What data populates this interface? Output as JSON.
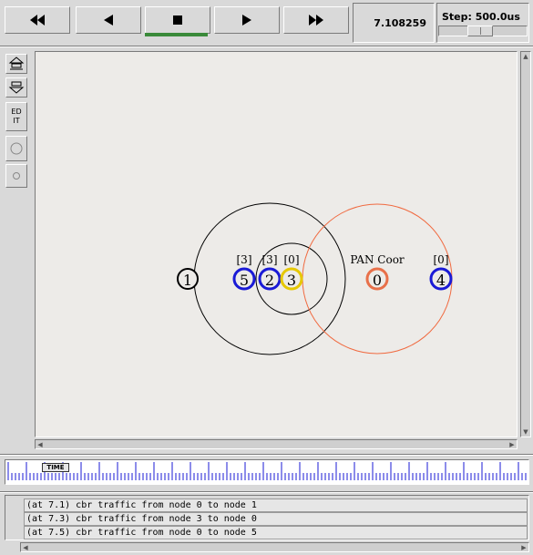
{
  "toolbar": {
    "rewind_icon": "fast-rewind-icon",
    "back_icon": "play-backward-icon",
    "stop_icon": "stop-icon",
    "play_icon": "play-forward-icon",
    "forward_icon": "fast-forward-icon",
    "time_value": "7.108259",
    "step_label": "Step: 500.0us"
  },
  "tools": {
    "edit_label": "ED\nIT"
  },
  "nodes": [
    {
      "id": "1",
      "label": "",
      "color": "#000000"
    },
    {
      "id": "5",
      "label": "[3]",
      "color": "#1a1ad6"
    },
    {
      "id": "2",
      "label": "[3]",
      "color": "#1a1ad6"
    },
    {
      "id": "3",
      "label": "[0]",
      "color": "#e6c800"
    },
    {
      "id": "0",
      "label": "PAN Coor",
      "color": "#e8704a"
    },
    {
      "id": "4",
      "label": "[0]",
      "color": "#1a1ad6"
    }
  ],
  "timeline": {
    "label": "TIME"
  },
  "log": [
    "(at 7.1) cbr traffic from node 0 to node 1",
    "(at 7.3) cbr traffic from node 3 to node 0",
    "(at 7.5) cbr traffic from node 0 to node 5"
  ],
  "colors": {
    "active_button_bar": "#3a8a3a",
    "range_black": "#000000",
    "range_orange": "#f06a40"
  }
}
